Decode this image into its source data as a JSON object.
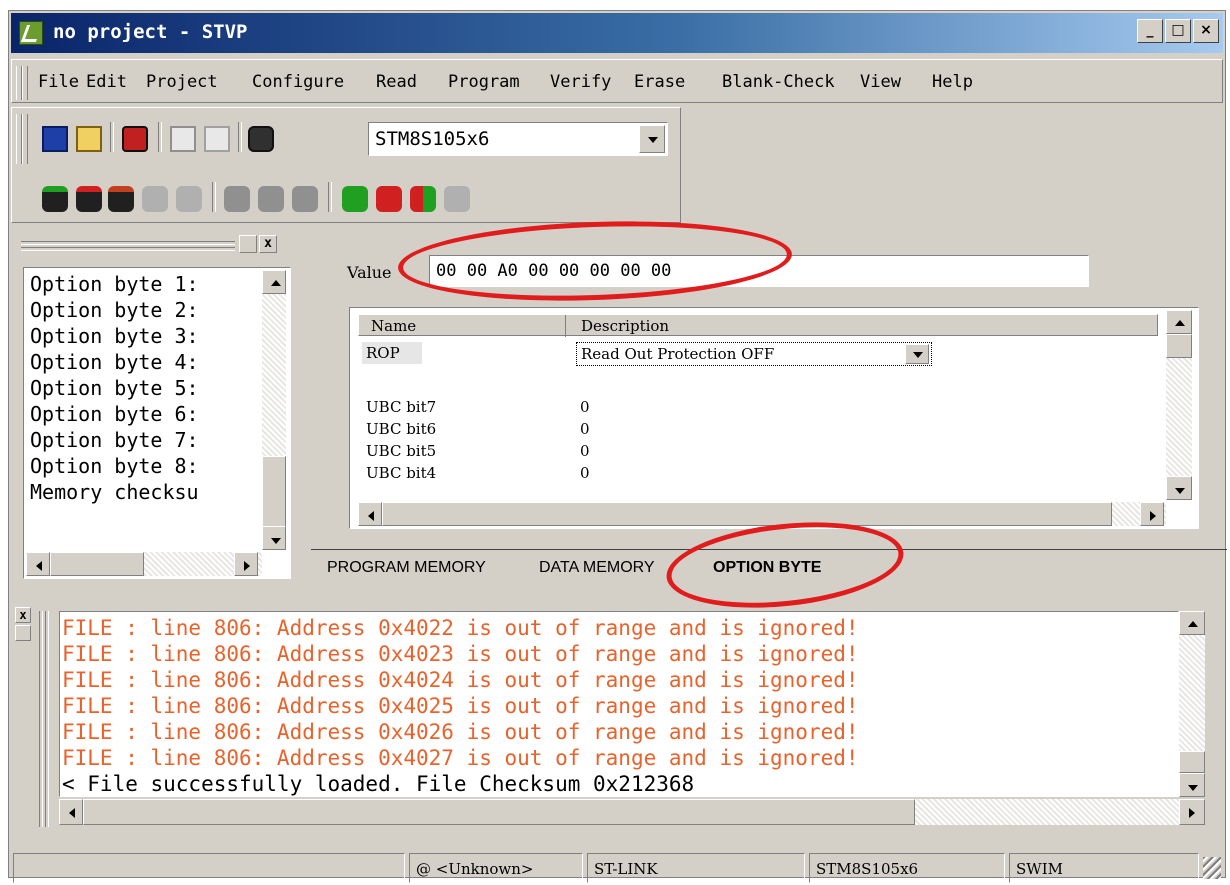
{
  "window": {
    "title": "no project - STVP",
    "buttons": {
      "minimize": "_",
      "maximize": "□",
      "close": "×"
    },
    "titlebar_color": "#0a246a"
  },
  "menu": [
    "File",
    "Edit",
    "Project",
    "Configure",
    "Read",
    "Program",
    "Verify",
    "Erase",
    "Blank-Check",
    "View",
    "Help"
  ],
  "toolbar": {
    "device_combo": {
      "value": "STM8S105x6"
    },
    "icons": [
      "save-icon",
      "open-icon",
      "project-icon",
      "copy-icon",
      "paste-icon",
      "device-icon",
      "read-icon",
      "read-red-icon",
      "read-green-icon",
      "read-gray-icon",
      "verify-gray-icon",
      "program-gray-icon",
      "program-gray2-icon",
      "program-gray3-icon",
      "green-chip-icon",
      "red-chip-icon",
      "redgreen-chip-icon",
      "gray-chip-icon"
    ]
  },
  "left_panel": {
    "items": [
      "Option byte 1:",
      "Option byte 2:",
      "Option byte 3:",
      "Option byte 4:",
      "Option byte 5:",
      "Option byte 6:",
      "Option byte 7:",
      "Option byte 8:",
      "Memory checksu"
    ]
  },
  "option_panel": {
    "value_label": "Value",
    "value": "00 00 A0 00 00 00 00 00",
    "columns": {
      "name": "Name",
      "description": "Description"
    },
    "rows": [
      {
        "name": "ROP",
        "description": "Read Out Protection OFF"
      },
      {
        "name": "UBC bit7",
        "description": "0"
      },
      {
        "name": "UBC bit6",
        "description": "0"
      },
      {
        "name": "UBC bit5",
        "description": "0"
      },
      {
        "name": "UBC bit4",
        "description": "0"
      }
    ]
  },
  "tabs": [
    "PROGRAM MEMORY",
    "DATA MEMORY",
    "OPTION BYTE"
  ],
  "active_tab": "OPTION BYTE",
  "output": {
    "lines": [
      "FILE : line 806: Address 0x4022 is out of range and is ignored!",
      "FILE : line 806: Address 0x4023 is out of range and is ignored!",
      "FILE : line 806: Address 0x4024 is out of range and is ignored!",
      "FILE : line 806: Address 0x4025 is out of range and is ignored!",
      "FILE : line 806: Address 0x4026 is out of range and is ignored!",
      "FILE : line 806: Address 0x4027 is out of range and is ignored!",
      "< File successfully loaded. File Checksum 0x212368"
    ],
    "warn_color": "#e8622c",
    "normal_color": "#000000"
  },
  "statusbar": {
    "cells": [
      "",
      "@ <Unknown>",
      "ST-LINK",
      "STM8S105x6",
      "SWIM"
    ]
  },
  "annotation_color": "#e01c1c"
}
